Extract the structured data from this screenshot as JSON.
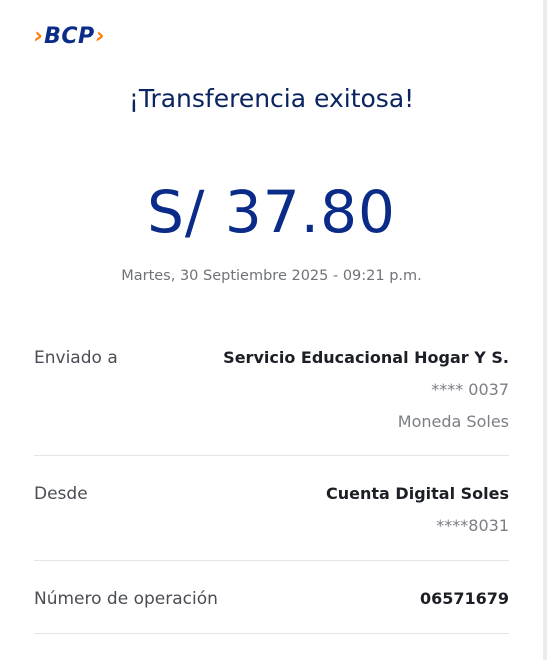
{
  "brand": {
    "logo_text": "BCP",
    "left_chevron": "›",
    "right_chevron": "›",
    "colors": {
      "accent": "#ff7a00",
      "primary": "#0a2c88"
    }
  },
  "receipt": {
    "title": "¡Transferencia exitosa!",
    "amount": "S/ 37.80",
    "datetime": "Martes, 30 Septiembre 2025 - 09:21 p.m.",
    "sent_to": {
      "label": "Enviado a",
      "name": "Servicio Educacional Hogar Y S.",
      "account": "**** 0037",
      "currency": "Moneda Soles"
    },
    "from": {
      "label": "Desde",
      "account_name": "Cuenta Digital Soles",
      "account_number": "****8031"
    },
    "operation": {
      "label": "Número de operación",
      "number": "06571679"
    }
  }
}
